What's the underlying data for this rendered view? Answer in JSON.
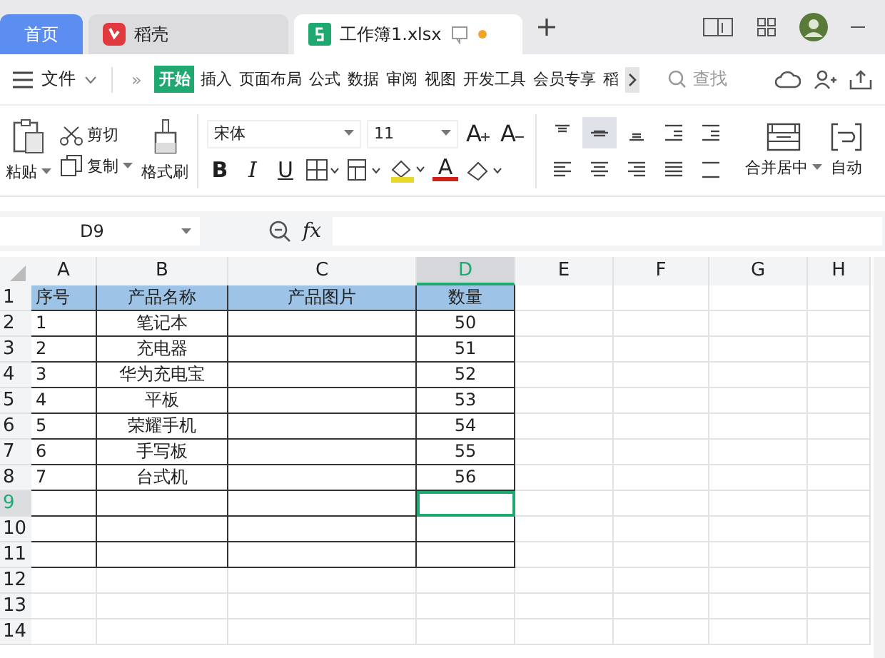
{
  "browser_tabs": [
    {
      "label": "首页",
      "kind": "home",
      "selected": false
    },
    {
      "label": "稻壳",
      "kind": "docer",
      "selected": false
    },
    {
      "label": "工作簿1.xlsx",
      "kind": "sheet",
      "selected": true
    }
  ],
  "menu": {
    "file": "文件",
    "more": "»",
    "search": "查找",
    "tabs": [
      {
        "label": "开始",
        "selected": true
      },
      {
        "label": "插入",
        "selected": false
      },
      {
        "label": "页面布局",
        "selected": false
      },
      {
        "label": "公式",
        "selected": false
      },
      {
        "label": "数据",
        "selected": false
      },
      {
        "label": "审阅",
        "selected": false
      },
      {
        "label": "视图",
        "selected": false
      },
      {
        "label": "开发工具",
        "selected": false
      },
      {
        "label": "会员专享",
        "selected": false
      },
      {
        "label": "稻",
        "selected": false
      }
    ]
  },
  "ribbon": {
    "paste": "粘贴",
    "cut": "剪切",
    "copy": "复制",
    "format_painter": "格式刷",
    "font": "宋体",
    "font_size": "11",
    "bold": "B",
    "italic": "I",
    "underline": "U",
    "grow": "A",
    "shrink": "A",
    "font_color": "A",
    "merge": "合并居中",
    "wrap": "自动",
    "align_buttons": [
      {
        "kind": "top",
        "selected": false
      },
      {
        "kind": "middle",
        "selected": true
      },
      {
        "kind": "bottom",
        "selected": false
      },
      {
        "kind": "outdent",
        "selected": false
      },
      {
        "kind": "indent",
        "selected": false
      },
      {
        "kind": "left",
        "selected": false
      },
      {
        "kind": "center",
        "selected": false
      },
      {
        "kind": "right",
        "selected": false
      },
      {
        "kind": "justify",
        "selected": false
      },
      {
        "kind": "distributed",
        "selected": false
      }
    ]
  },
  "formula_bar": {
    "name_box": "D9",
    "fx": "fx"
  },
  "sheet": {
    "columns": [
      {
        "label": "A",
        "selected": false
      },
      {
        "label": "B",
        "selected": false
      },
      {
        "label": "C",
        "selected": false
      },
      {
        "label": "D",
        "selected": true
      },
      {
        "label": "E",
        "selected": false
      },
      {
        "label": "F",
        "selected": false
      },
      {
        "label": "G",
        "selected": false
      },
      {
        "label": "H",
        "selected": false
      }
    ],
    "rows": [
      {
        "number": "1",
        "kind": "header",
        "bordered": true,
        "selected": false,
        "cells": [
          "序号",
          "产品名称",
          "产品图片",
          "数量"
        ]
      },
      {
        "number": "2",
        "kind": "data",
        "bordered": true,
        "selected": false,
        "cells": [
          "1",
          "笔记本",
          null,
          "50"
        ]
      },
      {
        "number": "3",
        "kind": "data",
        "bordered": true,
        "selected": false,
        "cells": [
          "2",
          "充电器",
          null,
          "51"
        ]
      },
      {
        "number": "4",
        "kind": "data",
        "bordered": true,
        "selected": false,
        "cells": [
          "3",
          "华为充电宝",
          null,
          "52"
        ]
      },
      {
        "number": "5",
        "kind": "data",
        "bordered": true,
        "selected": false,
        "cells": [
          "4",
          "平板",
          null,
          "53"
        ]
      },
      {
        "number": "6",
        "kind": "data",
        "bordered": true,
        "selected": false,
        "cells": [
          "5",
          "荣耀手机",
          null,
          "54"
        ]
      },
      {
        "number": "7",
        "kind": "data",
        "bordered": true,
        "selected": false,
        "cells": [
          "6",
          "手写板",
          null,
          "55"
        ]
      },
      {
        "number": "8",
        "kind": "data",
        "bordered": true,
        "selected": false,
        "cells": [
          "7",
          "台式机",
          null,
          "56"
        ]
      },
      {
        "number": "9",
        "kind": "data",
        "bordered": true,
        "selected": true
      },
      {
        "number": "10",
        "kind": "data",
        "bordered": true,
        "selected": false
      },
      {
        "number": "11",
        "kind": "data",
        "bordered": true,
        "selected": false
      },
      {
        "number": "12",
        "kind": "data",
        "bordered": false,
        "selected": false
      },
      {
        "number": "13",
        "kind": "data",
        "bordered": false,
        "selected": false
      },
      {
        "number": "14",
        "kind": "data",
        "bordered": false,
        "selected": false
      }
    ]
  }
}
